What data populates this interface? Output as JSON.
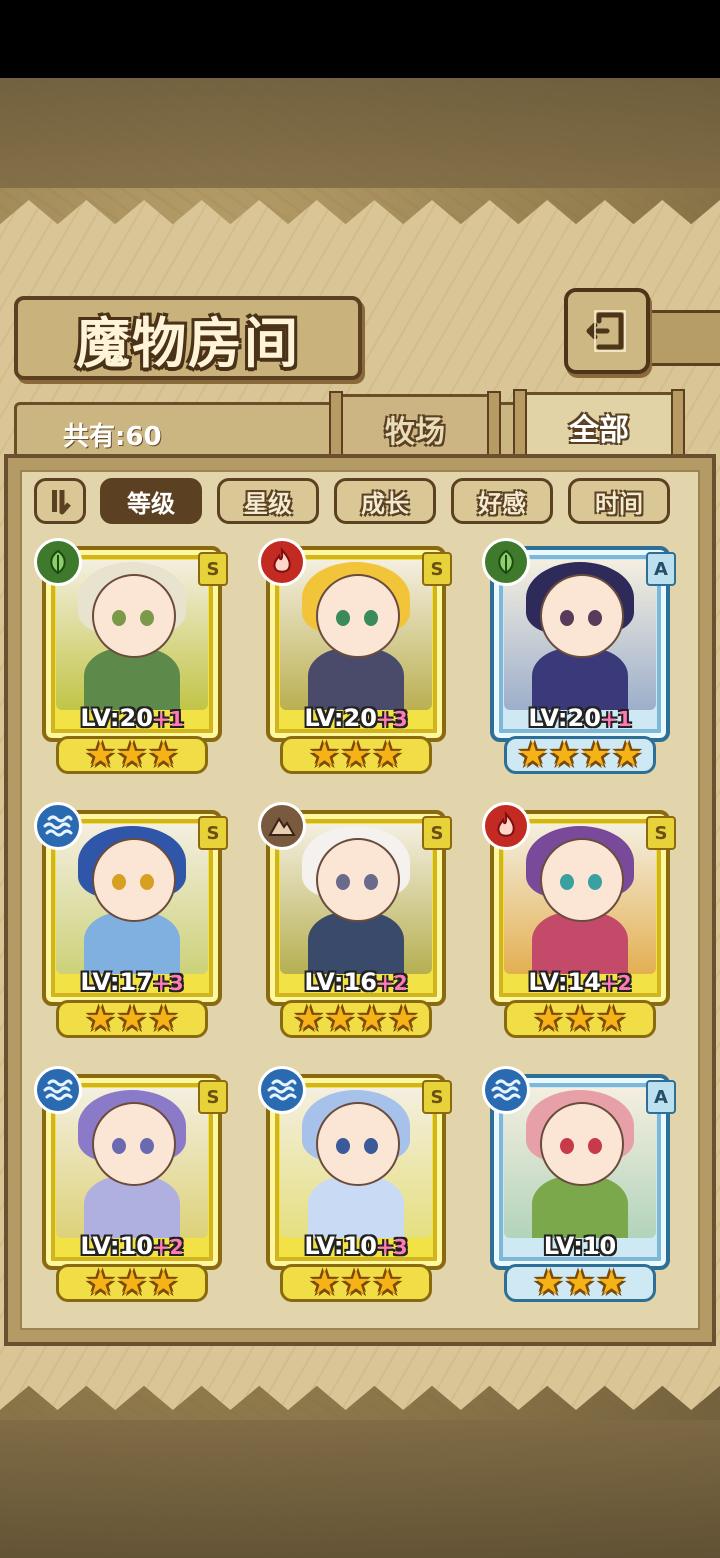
{
  "title": "魔物房间",
  "count_label": "共有:60",
  "tabs": [
    {
      "label": "牧场",
      "active": false
    },
    {
      "label": "全部",
      "active": true
    }
  ],
  "sort_buttons": [
    {
      "label": "等级",
      "active": true
    },
    {
      "label": "星级",
      "active": false
    },
    {
      "label": "成长",
      "active": false
    },
    {
      "label": "好感",
      "active": false
    },
    {
      "label": "时间",
      "active": false
    }
  ],
  "monsters": [
    {
      "element": "grass",
      "rank": "S",
      "frame": "gold",
      "level": "LV:20",
      "plus": "+1",
      "stars": 3,
      "hair": "#e8e3cf",
      "body": "#5d8a4a",
      "eye": "#7a9a4a"
    },
    {
      "element": "fire",
      "rank": "S",
      "frame": "gold",
      "level": "LV:20",
      "plus": "+3",
      "stars": 3,
      "hair": "#f2c43a",
      "body": "#4a4a6a",
      "eye": "#3a8a5a"
    },
    {
      "element": "grass",
      "rank": "A",
      "frame": "blue",
      "level": "LV:20",
      "plus": "+1",
      "stars": 4,
      "hair": "#2e2a5a",
      "body": "#3a3a7a",
      "eye": "#5a3a5a"
    },
    {
      "element": "water",
      "rank": "S",
      "frame": "gold",
      "level": "LV:17",
      "plus": "+3",
      "stars": 3,
      "hair": "#2f56a8",
      "body": "#7fb0e0",
      "eye": "#d8a020"
    },
    {
      "element": "earth",
      "rank": "S",
      "frame": "gold",
      "level": "LV:16",
      "plus": "+2",
      "stars": 4,
      "hair": "#f4f1ee",
      "body": "#3a4a6a",
      "eye": "#6a6a8a"
    },
    {
      "element": "fire",
      "rank": "S",
      "frame": "gold",
      "level": "LV:14",
      "plus": "+2",
      "stars": 3,
      "hair": "#7a4a9a",
      "body": "#c44a6a",
      "eye": "#3aa0a0"
    },
    {
      "element": "water",
      "rank": "S",
      "frame": "gold",
      "level": "LV:10",
      "plus": "+2",
      "stars": 3,
      "hair": "#8a7ac8",
      "body": "#b0b0e0",
      "eye": "#6a6ab0"
    },
    {
      "element": "water",
      "rank": "S",
      "frame": "gold",
      "level": "LV:10",
      "plus": "+3",
      "stars": 3,
      "hair": "#a6c2ea",
      "body": "#c8daf4",
      "eye": "#3a5a9a"
    },
    {
      "element": "water",
      "rank": "A",
      "frame": "blue",
      "level": "LV:10",
      "plus": "",
      "stars": 3,
      "hair": "#e8a0a8",
      "body": "#7aa84a",
      "eye": "#c83a4a"
    }
  ]
}
